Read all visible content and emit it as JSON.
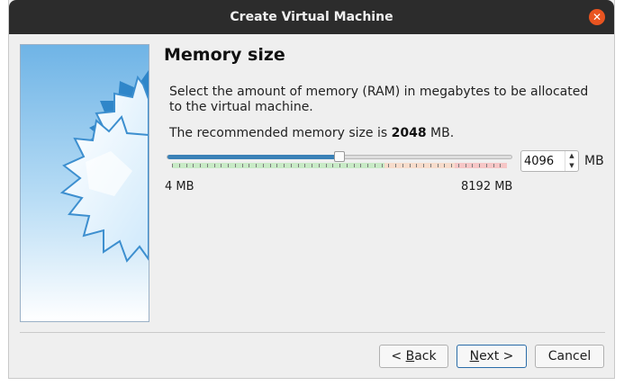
{
  "window": {
    "title": "Create Virtual Machine"
  },
  "page": {
    "title": "Memory size",
    "description": "Select the amount of memory (RAM) in megabytes to be allocated to the virtual machine.",
    "recommended_prefix": "The recommended memory size is ",
    "recommended_value": "2048",
    "recommended_suffix": " MB."
  },
  "memory": {
    "value": "4096",
    "unit": "MB",
    "min_label": "4 MB",
    "max_label": "8192 MB",
    "slider_fraction": 0.5
  },
  "buttons": {
    "back_prefix": "< ",
    "back_mnemonic": "B",
    "back_rest": "ack",
    "next_mnemonic": "N",
    "next_rest": "ext >",
    "cancel": "Cancel"
  },
  "icons": {
    "close": "close-icon",
    "spin_up": "up-arrow-icon",
    "spin_down": "down-arrow-icon",
    "side_art": "virtualbox-wizard-gear-art"
  },
  "colors": {
    "titlebar": "#2c2c2c",
    "close": "#e95420",
    "slider_fill": "#3a81b7",
    "zone_safe": "#8ed08c",
    "zone_warn": "#f2c3a6",
    "zone_danger": "#f0a3a3"
  }
}
